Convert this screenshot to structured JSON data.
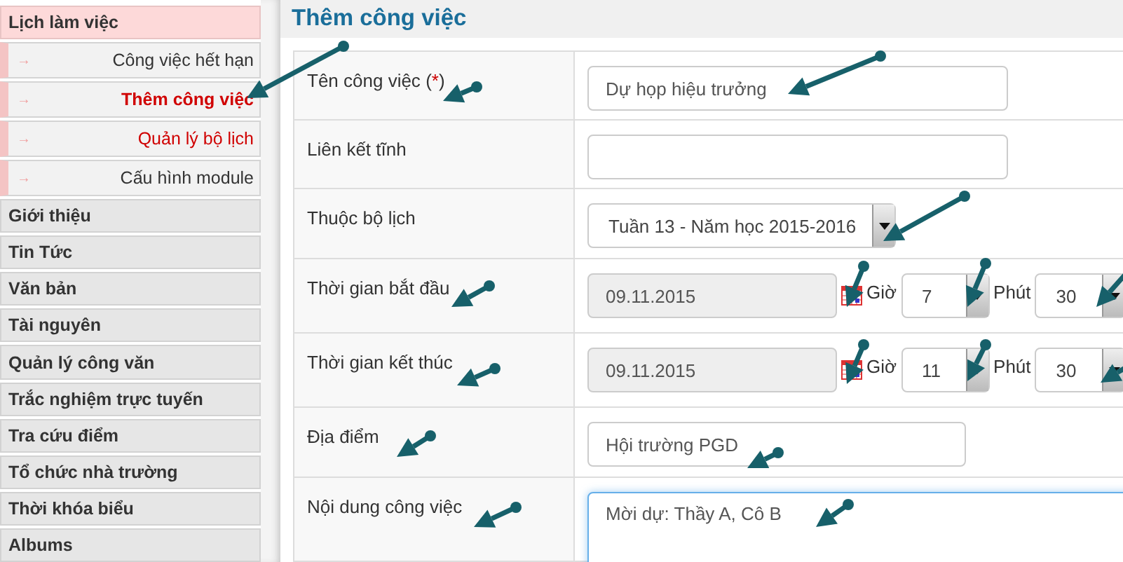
{
  "sidebar": {
    "groups": [
      {
        "label": "Lịch làm việc",
        "expanded": true,
        "children": [
          {
            "arrow": "→",
            "label": "Công việc hết hạn",
            "selected": false,
            "highlighted": false
          },
          {
            "arrow": "→",
            "label": "Thêm công việc",
            "selected": true,
            "highlighted": false
          },
          {
            "arrow": "→",
            "label": "Quản lý bộ lịch",
            "selected": false,
            "highlighted": true
          },
          {
            "arrow": "→",
            "label": "Cấu hình module",
            "selected": false,
            "highlighted": false
          }
        ]
      },
      {
        "label": "Giới thiệu",
        "expanded": false
      },
      {
        "label": "Tin Tức",
        "expanded": false
      },
      {
        "label": "Văn bản",
        "expanded": false
      },
      {
        "label": "Tài nguyên",
        "expanded": false
      },
      {
        "label": "Quản lý công văn",
        "expanded": false
      },
      {
        "label": "Trắc nghiệm trực tuyến",
        "expanded": false
      },
      {
        "label": "Tra cứu điểm",
        "expanded": false
      },
      {
        "label": "Tổ chức nhà trường",
        "expanded": false
      },
      {
        "label": "Thời khóa biểu",
        "expanded": false
      },
      {
        "label": "Albums",
        "expanded": false
      }
    ]
  },
  "page": {
    "title": "Thêm công việc"
  },
  "form": {
    "rows": [
      {
        "kind": "text",
        "label": "Tên công việc",
        "required_mark": "(*)",
        "value": "Dự họp hiệu trưởng"
      },
      {
        "kind": "text",
        "label": "Liên kết tĩnh"
      },
      {
        "kind": "select",
        "label": "Thuộc bộ lịch",
        "value": "Tuần 13 - Năm học 2015-2016"
      },
      {
        "kind": "datetime",
        "label": "Thời gian bắt đầu",
        "date": "09.11.2015",
        "date_disabled": true,
        "hour_label": "Giờ",
        "hour": "7",
        "minute_label": "Phút",
        "minute": "30"
      },
      {
        "kind": "datetime",
        "label": "Thời gian kết thúc",
        "date": "09.11.2015",
        "date_disabled": true,
        "hour_label": "Giờ",
        "hour": "11",
        "minute_label": "Phút",
        "minute": "30"
      },
      {
        "kind": "short_text",
        "label": "Địa điểm",
        "value": "Hội trường PGD"
      },
      {
        "kind": "textarea",
        "label": "Nội dung công việc",
        "value": "Mời dự: Thầy A, Cô B",
        "focused": true
      }
    ]
  }
}
